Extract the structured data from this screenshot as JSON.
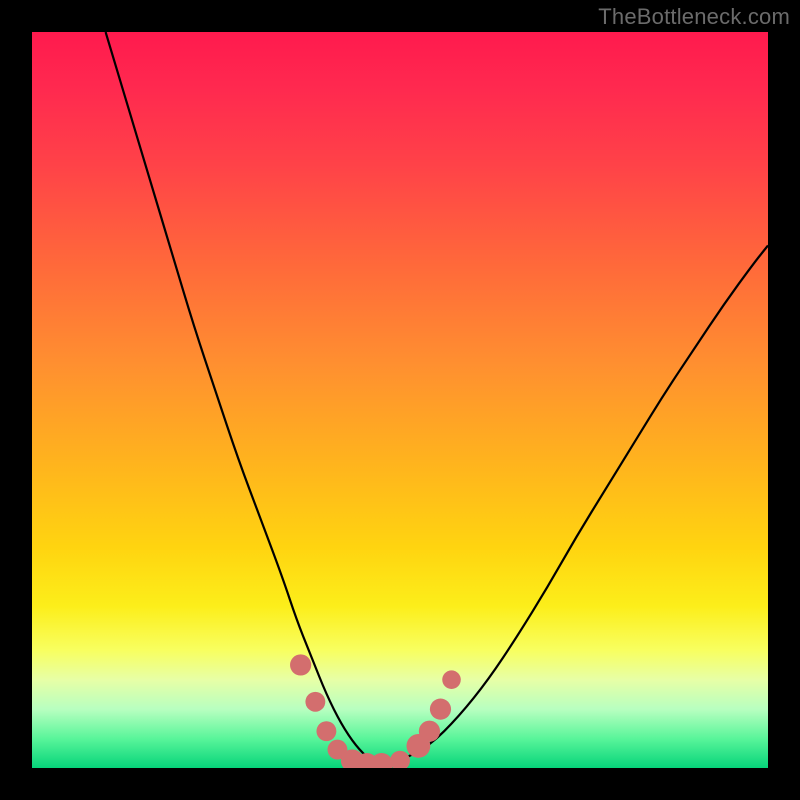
{
  "watermark": "TheBottleneck.com",
  "chart_data": {
    "type": "line",
    "title": "",
    "xlabel": "",
    "ylabel": "",
    "xlim": [
      0,
      100
    ],
    "ylim": [
      0,
      100
    ],
    "grid": false,
    "series": [
      {
        "name": "bottleneck-curve",
        "x": [
          10,
          13,
          16,
          19,
          22,
          25,
          28,
          31,
          34,
          36,
          38,
          40,
          42,
          44,
          46,
          48,
          50,
          54,
          58,
          62,
          66,
          70,
          74,
          78,
          82,
          86,
          90,
          94,
          98,
          100
        ],
        "y": [
          100,
          90,
          80,
          70,
          60,
          51,
          42,
          34,
          26,
          20,
          15,
          10,
          6,
          3,
          1,
          0,
          1,
          3,
          7,
          12,
          18,
          24.5,
          31.5,
          38,
          44.5,
          51,
          57,
          63,
          68.5,
          71
        ]
      }
    ],
    "markers": [
      {
        "x": 36.5,
        "y": 14,
        "r": 1.6
      },
      {
        "x": 38.5,
        "y": 9,
        "r": 1.5
      },
      {
        "x": 40.0,
        "y": 5,
        "r": 1.5
      },
      {
        "x": 41.5,
        "y": 2.5,
        "r": 1.5
      },
      {
        "x": 43.5,
        "y": 1,
        "r": 1.7
      },
      {
        "x": 45.5,
        "y": 0.5,
        "r": 1.7
      },
      {
        "x": 47.5,
        "y": 0.5,
        "r": 1.7
      },
      {
        "x": 50.0,
        "y": 1,
        "r": 1.5
      },
      {
        "x": 52.5,
        "y": 3,
        "r": 1.8
      },
      {
        "x": 54.0,
        "y": 5,
        "r": 1.6
      },
      {
        "x": 55.5,
        "y": 8,
        "r": 1.6
      },
      {
        "x": 57.0,
        "y": 12,
        "r": 1.4
      }
    ],
    "colors": {
      "curve": "#000000",
      "markers": "#d36e6e",
      "gradient_top": "#ff1a4e",
      "gradient_mid": "#ffd410",
      "gradient_bottom": "#06d47a",
      "frame": "#000000"
    }
  }
}
